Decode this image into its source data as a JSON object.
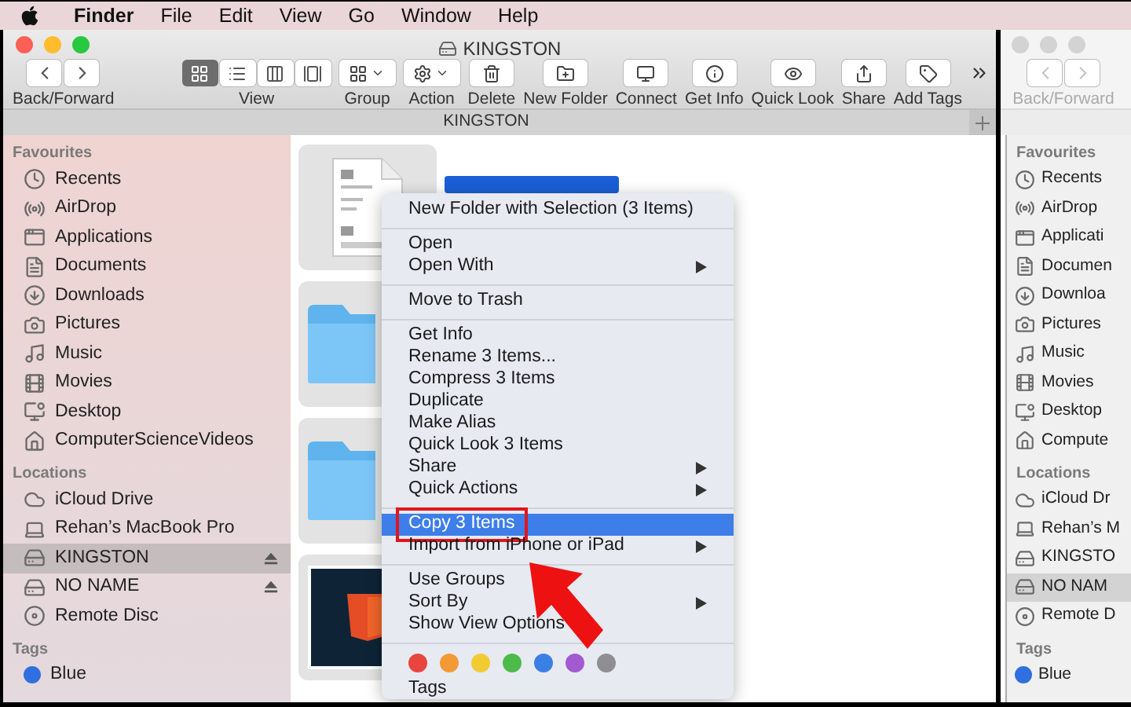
{
  "menu_bar": {
    "app": "Finder",
    "menus": [
      "File",
      "Edit",
      "View",
      "Go",
      "Window",
      "Help"
    ]
  },
  "window": {
    "title": "KINGSTON",
    "toolbar": [
      {
        "kind": "back-forward",
        "label": "Back/Forward",
        "disabled": false
      },
      {
        "kind": "view",
        "label": "View",
        "modes": [
          {
            "selected": true
          },
          {
            "selected": false
          },
          {
            "selected": false
          },
          {
            "selected": false
          }
        ]
      },
      {
        "kind": "dropdown",
        "label": "Group"
      },
      {
        "kind": "dropdown",
        "label": "Action"
      },
      {
        "kind": "button",
        "label": "Delete"
      },
      {
        "kind": "button",
        "label": "New Folder"
      },
      {
        "kind": "button",
        "label": "Connect"
      },
      {
        "kind": "button",
        "label": "Get Info"
      },
      {
        "kind": "button",
        "label": "Quick Look"
      },
      {
        "kind": "button",
        "label": "Share"
      },
      {
        "kind": "button",
        "label": "Add Tags"
      },
      {
        "kind": "overflow"
      }
    ],
    "tab_bar": {
      "title": "KINGSTON"
    },
    "sidebar": {
      "sections": [
        {
          "heading": "Favourites",
          "items": [
            {
              "label": "Recents",
              "selected": false
            },
            {
              "label": "AirDrop",
              "selected": false
            },
            {
              "label": "Applications",
              "selected": false
            },
            {
              "label": "Documents",
              "selected": false
            },
            {
              "label": "Downloads",
              "selected": false
            },
            {
              "label": "Pictures",
              "selected": false
            },
            {
              "label": "Music",
              "selected": false
            },
            {
              "label": "Movies",
              "selected": false
            },
            {
              "label": "Desktop",
              "selected": false
            },
            {
              "label": "ComputerScienceVideos",
              "selected": false
            }
          ]
        },
        {
          "heading": "Locations",
          "items": [
            {
              "label": "iCloud Drive",
              "selected": false,
              "eject": false
            },
            {
              "label": "Rehan’s MacBook Pro",
              "selected": false,
              "eject": false
            },
            {
              "label": "KINGSTON",
              "selected": true,
              "eject": true
            },
            {
              "label": "NO NAME",
              "selected": false,
              "eject": true
            },
            {
              "label": "Remote Disc",
              "selected": false,
              "eject": false
            }
          ]
        },
        {
          "heading": "Tags",
          "items": [
            {
              "label": "Blue",
              "selected": false,
              "color": "#2f6fe0"
            }
          ]
        }
      ]
    },
    "files": [
      {
        "kind": "document",
        "selected": true,
        "label_highlighted": true
      },
      {
        "kind": "folder",
        "selected": true
      },
      {
        "kind": "folder",
        "selected": true
      },
      {
        "kind": "image",
        "selected": true
      }
    ]
  },
  "context_menu": {
    "groups": [
      {
        "items": [
          {
            "label": "New Folder with Selection (3 Items)",
            "submenu": false,
            "selected": false,
            "callout": false
          }
        ]
      },
      {
        "items": [
          {
            "label": "Open",
            "submenu": false,
            "selected": false,
            "callout": false
          },
          {
            "label": "Open With",
            "submenu": true,
            "selected": false,
            "callout": false
          }
        ]
      },
      {
        "items": [
          {
            "label": "Move to Trash",
            "submenu": false,
            "selected": false,
            "callout": false
          }
        ]
      },
      {
        "items": [
          {
            "label": "Get Info",
            "submenu": false,
            "selected": false,
            "callout": false
          },
          {
            "label": "Rename 3 Items...",
            "submenu": false,
            "selected": false,
            "callout": false
          },
          {
            "label": "Compress 3 Items",
            "submenu": false,
            "selected": false,
            "callout": false
          },
          {
            "label": "Duplicate",
            "submenu": false,
            "selected": false,
            "callout": false
          },
          {
            "label": "Make Alias",
            "submenu": false,
            "selected": false,
            "callout": false
          },
          {
            "label": "Quick Look 3 Items",
            "submenu": false,
            "selected": false,
            "callout": false
          },
          {
            "label": "Share",
            "submenu": true,
            "selected": false,
            "callout": false
          },
          {
            "label": "Quick Actions",
            "submenu": true,
            "selected": false,
            "callout": false
          }
        ]
      },
      {
        "items": [
          {
            "label": "Copy 3 Items",
            "submenu": false,
            "selected": true,
            "callout": true
          },
          {
            "label": "Import from iPhone or iPad",
            "submenu": true,
            "selected": false,
            "callout": false
          }
        ]
      },
      {
        "items": [
          {
            "label": "Use Groups",
            "submenu": false,
            "selected": false,
            "callout": false
          },
          {
            "label": "Sort By",
            "submenu": true,
            "selected": false,
            "callout": false
          },
          {
            "label": "Show View Options",
            "submenu": false,
            "selected": false,
            "callout": false
          }
        ]
      }
    ],
    "tag_colors": [
      {
        "color": "#e8453f"
      },
      {
        "color": "#f39a36"
      },
      {
        "color": "#f2cb33"
      },
      {
        "color": "#4cbb4a"
      },
      {
        "color": "#3a7fe3"
      },
      {
        "color": "#a25ad0"
      },
      {
        "color": "#8e8e93"
      }
    ],
    "footer": "Tags"
  },
  "second_window": {
    "nav": {
      "label": "Back/Forward",
      "disabled": true
    },
    "sidebar": {
      "sections": [
        {
          "heading": "Favourites",
          "items": [
            {
              "label": "Recents",
              "selected": false
            },
            {
              "label": "AirDrop",
              "selected": false
            },
            {
              "label": "Applicati",
              "selected": false
            },
            {
              "label": "Documen",
              "selected": false
            },
            {
              "label": "Downloa",
              "selected": false
            },
            {
              "label": "Pictures",
              "selected": false
            },
            {
              "label": "Music",
              "selected": false
            },
            {
              "label": "Movies",
              "selected": false
            },
            {
              "label": "Desktop",
              "selected": false
            },
            {
              "label": "Compute",
              "selected": false
            }
          ]
        },
        {
          "heading": "Locations",
          "items": [
            {
              "label": "iCloud Dr",
              "selected": false
            },
            {
              "label": "Rehan’s M",
              "selected": false
            },
            {
              "label": "KINGSTO",
              "selected": false
            },
            {
              "label": "NO NAM",
              "selected": true
            },
            {
              "label": "Remote D",
              "selected": false
            }
          ]
        },
        {
          "heading": "Tags",
          "items": [
            {
              "label": "Blue",
              "selected": false,
              "color": "#2f6fe0"
            }
          ]
        }
      ]
    }
  }
}
